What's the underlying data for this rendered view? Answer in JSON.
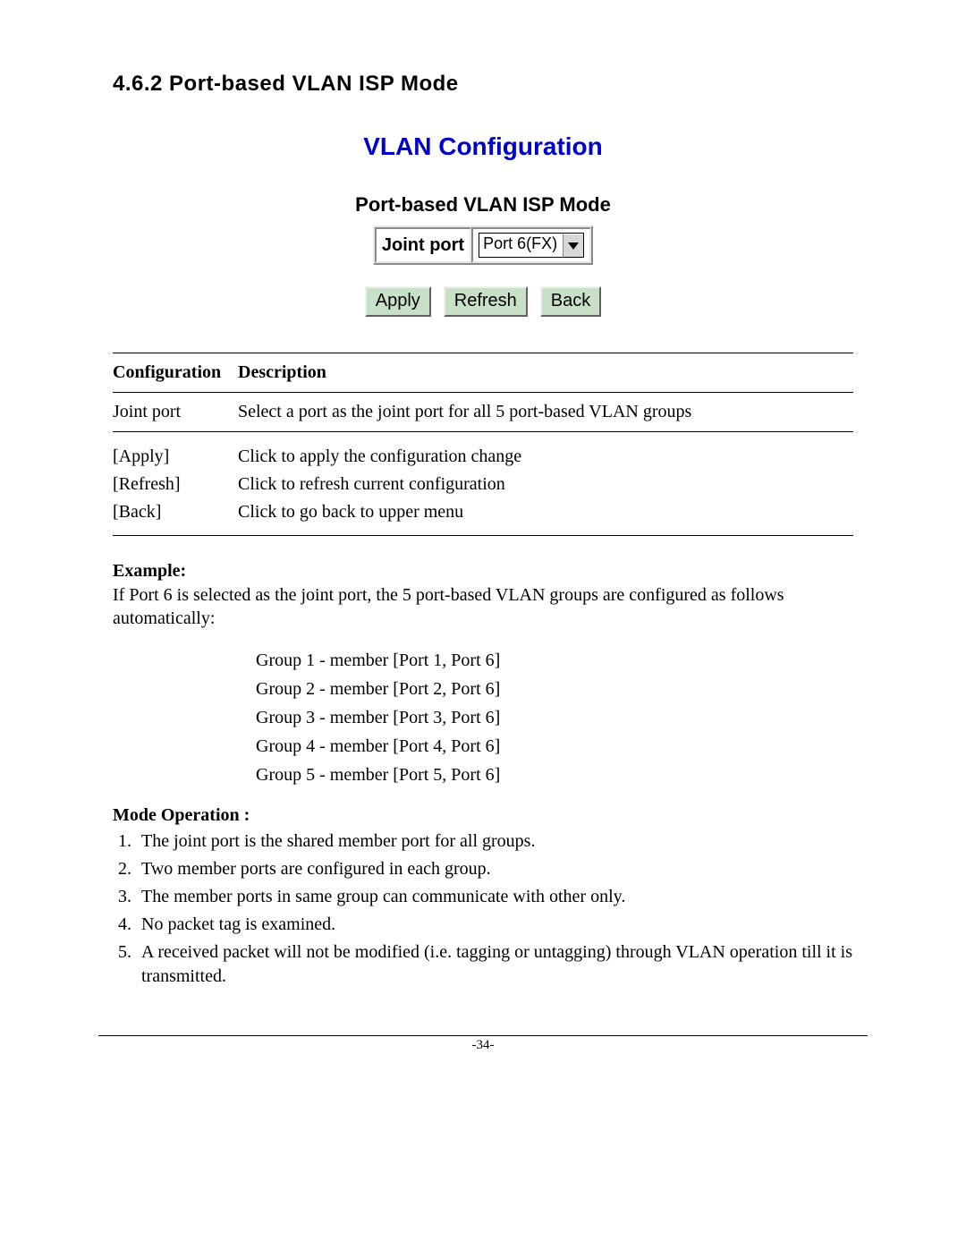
{
  "section_heading": "4.6.2 Port-based VLAN ISP Mode",
  "screenshot": {
    "title": "VLAN Configuration",
    "mode_title": "Port-based VLAN ISP Mode",
    "joint_port_label": "Joint port",
    "joint_port_value": "Port 6(FX)",
    "buttons": {
      "apply": "Apply",
      "refresh": "Refresh",
      "back": "Back"
    }
  },
  "config_table": {
    "headers": {
      "col1": "Configuration",
      "col2": "Description"
    },
    "rows": [
      {
        "c1": "Joint port",
        "c2": "Select a port as the joint port for all 5 port-based VLAN groups"
      },
      {
        "c1": "[Apply]",
        "c2": "Click to apply the configuration change"
      },
      {
        "c1": "[Refresh]",
        "c2": "Click to refresh current configuration"
      },
      {
        "c1": "[Back]",
        "c2": "Click to go back to upper menu"
      }
    ]
  },
  "example": {
    "title": "Example:",
    "text": "If Port 6 is selected as the joint port, the 5 port-based VLAN groups are configured as follows automatically:",
    "groups": [
      "Group 1 - member [Port 1, Port 6]",
      "Group 2 - member [Port 2, Port 6]",
      "Group 3 - member [Port 3, Port 6]",
      "Group 4 - member [Port 4, Port 6]",
      "Group 5 - member [Port 5, Port 6]"
    ]
  },
  "mode_operation": {
    "title": "Mode Operation :",
    "items": [
      "The joint port is the shared member port for all groups.",
      "Two member ports are configured in each group.",
      "The member ports in same group can communicate with other only.",
      "No packet tag is examined.",
      "A received packet will not be modified (i.e. tagging or untagging) through VLAN operation till it is transmitted."
    ]
  },
  "page_number": "-34-"
}
